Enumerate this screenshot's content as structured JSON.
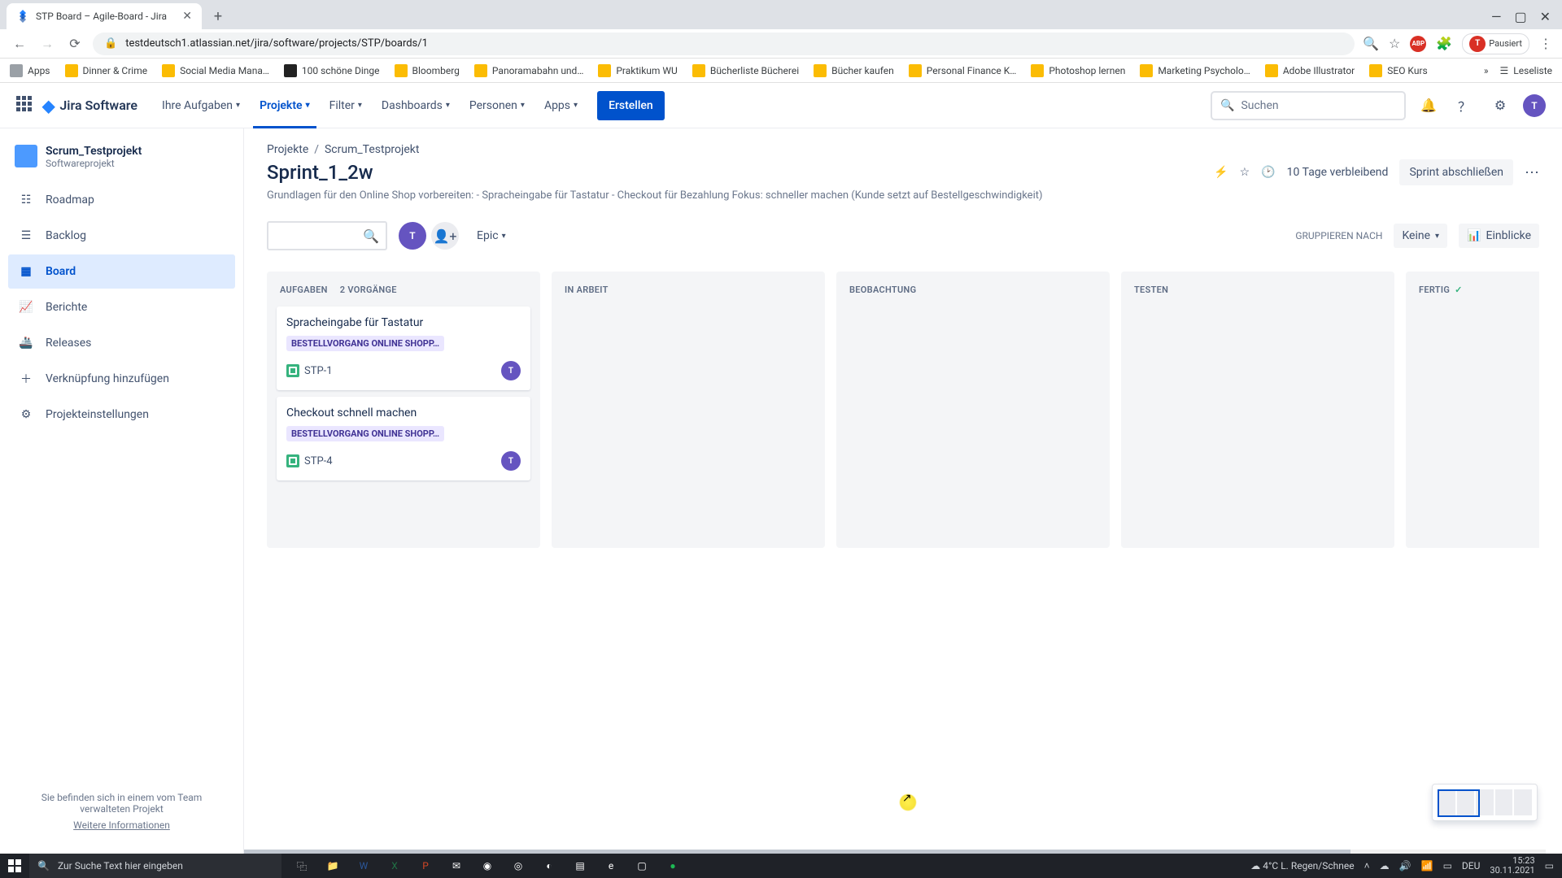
{
  "browser": {
    "tab_title": "STP Board – Agile-Board - Jira",
    "url": "testdeutsch1.atlassian.net/jira/software/projects/STP/boards/1",
    "profile_state": "Pausiert",
    "bookmarks": [
      "Apps",
      "Dinner & Crime",
      "Social Media Mana…",
      "100 schöne Dinge",
      "Bloomberg",
      "Panoramabahn und…",
      "Praktikum WU",
      "Bücherliste Bücherei",
      "Bücher kaufen",
      "Personal Finance K…",
      "Photoshop lernen",
      "Marketing Psycholo…",
      "Adobe Illustrator",
      "SEO Kurs"
    ],
    "bookmarks_overflow": "»",
    "reading_list": "Leseliste"
  },
  "jira_nav": {
    "product": "Jira Software",
    "items": [
      "Ihre Aufgaben",
      "Projekte",
      "Filter",
      "Dashboards",
      "Personen",
      "Apps"
    ],
    "active_index": 1,
    "create": "Erstellen",
    "search_placeholder": "Suchen",
    "avatar_initial": "T"
  },
  "sidebar": {
    "project_name": "Scrum_Testprojekt",
    "project_type": "Softwareprojekt",
    "items": [
      "Roadmap",
      "Backlog",
      "Board",
      "Berichte",
      "Releases",
      "Verknüpfung hinzufügen",
      "Projekteinstellungen"
    ],
    "active_index": 2,
    "footer_line": "Sie befinden sich in einem vom Team verwalteten Projekt",
    "footer_link": "Weitere Informationen"
  },
  "header": {
    "breadcrumb_root": "Projekte",
    "breadcrumb_project": "Scrum_Testprojekt",
    "sprint_title": "Sprint_1_2w",
    "description": "Grundlagen für den Online Shop vorbereiten: - Spracheingabe für Tastatur - Checkout für Bezahlung Fokus: schneller machen (Kunde setzt auf Bestellgeschwindigkeit)",
    "days_remaining": "10 Tage verbleibend",
    "complete_sprint": "Sprint abschließen"
  },
  "controls": {
    "epic_label": "Epic",
    "group_by_label": "GRUPPIEREN NACH",
    "group_by_value": "Keine",
    "insights": "Einblicke",
    "avatar_initial": "T"
  },
  "columns": [
    {
      "title": "AUFGABEN",
      "count_label": "2 VORGÄNGE"
    },
    {
      "title": "IN ARBEIT"
    },
    {
      "title": "BEOBACHTUNG"
    },
    {
      "title": "TESTEN"
    },
    {
      "title": "FERTIG",
      "done": true
    }
  ],
  "cards": [
    {
      "title": "Spracheingabe für Tastatur",
      "epic": "BESTELLVORGANG ONLINE SHOPP…",
      "key": "STP-1",
      "assignee": "T"
    },
    {
      "title": "Checkout schnell machen",
      "epic": "BESTELLVORGANG ONLINE SHOPP…",
      "key": "STP-4",
      "assignee": "T"
    }
  ],
  "taskbar": {
    "search_placeholder": "Zur Suche Text hier eingeben",
    "weather": "4°C  L. Regen/Schnee",
    "lang": "DEU",
    "time": "15:23",
    "date": "30.11.2021"
  }
}
